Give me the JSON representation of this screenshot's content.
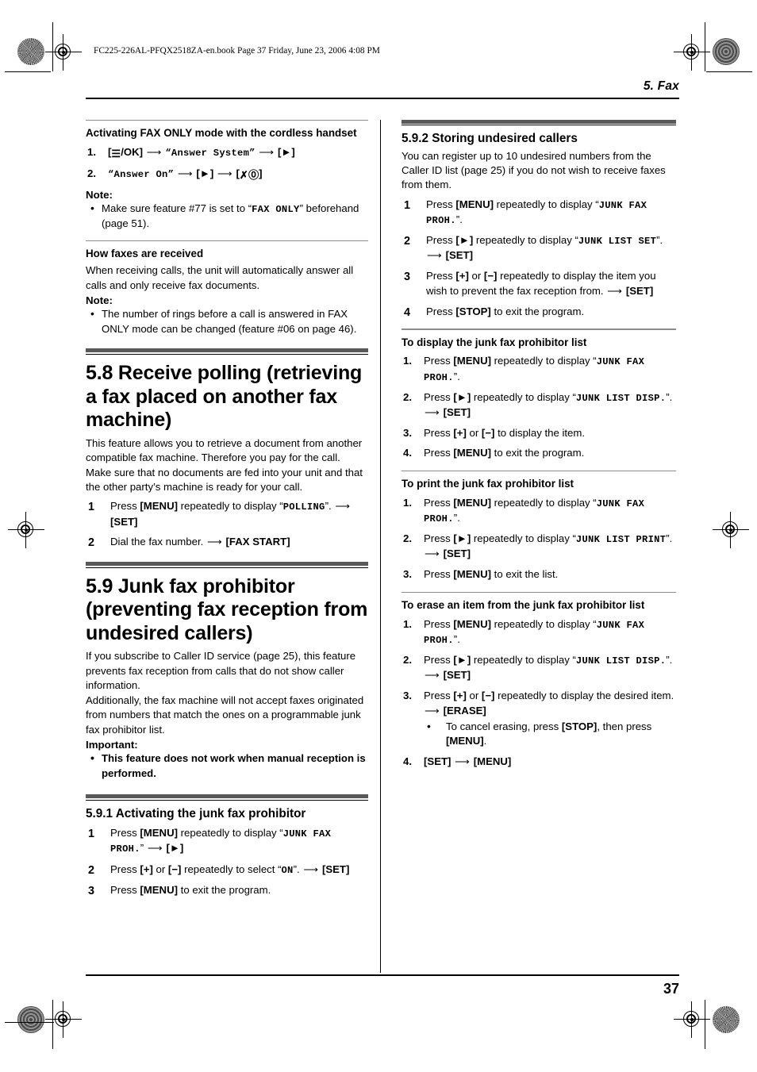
{
  "book_info_line": "FC225-226AL-PFQX2518ZA-en.book  Page 37  Friday, June 23, 2006  4:08 PM",
  "running_head": "5. Fax",
  "folio": "37",
  "left_column": {
    "cordless": {
      "heading": "Activating FAX ONLY mode with the cordless handset",
      "steps": [
        {
          "num": "1.",
          "parts": [
            "key:[≡/OK]",
            "arrow",
            "lcd:“Answer System”",
            "arrow",
            "key:[►]"
          ]
        },
        {
          "num": "2.",
          "parts": [
            "lcd:“Answer On”",
            "arrow",
            "key:[►]",
            "arrow",
            "key:[✗⓪]"
          ]
        }
      ],
      "note_label": "Note:",
      "notes": [
        "Make sure feature #77 is set to “FAX ONLY” beforehand (page 51)."
      ],
      "note_lcd": "FAX ONLY"
    },
    "how_received": {
      "heading": "How faxes are received",
      "body": "When receiving calls, the unit will automatically answer all calls and only receive fax documents.",
      "note_label": "Note:",
      "notes": [
        "The number of rings before a call is answered in FAX ONLY mode can be changed (feature #06 on page 46)."
      ]
    },
    "section_58": {
      "title": "5.8 Receive polling (retrieving a fax placed on another fax machine)",
      "paragraphs": [
        "This feature allows you to retrieve a document from another compatible fax machine. Therefore you pay for the call.",
        "Make sure that no documents are fed into your unit and that the other party’s machine is ready for your call."
      ],
      "steps": [
        {
          "num": "1",
          "text_a": "Press ",
          "key1": "[MENU]",
          "text_b": " repeatedly to display “",
          "lcd": "POLLING",
          "text_c": "”. ",
          "arrow": true,
          "key2": "[SET]"
        },
        {
          "num": "2",
          "text_a": "Dial the fax number. ",
          "arrow": true,
          "key2": "[FAX START]"
        }
      ]
    },
    "section_59": {
      "title": "5.9 Junk fax prohibitor (preventing fax reception from undesired callers)",
      "paragraphs": [
        "If you subscribe to Caller ID service (page 25), this feature prevents fax reception from calls that do not show caller information.",
        "Additionally, the fax machine will not accept faxes originated from numbers that match the ones on a programmable junk fax prohibitor list."
      ],
      "important_label": "Important:",
      "important_items": [
        "This feature does not work when manual reception is performed."
      ]
    },
    "section_591": {
      "title": "5.9.1 Activating the junk fax prohibitor",
      "steps": [
        {
          "num": "1",
          "a": "Press ",
          "k1": "[MENU]",
          "b": " repeatedly to display “",
          "lcd": "JUNK FAX PROH.",
          "c": "” ",
          "arrow": true,
          "k2": "[►]"
        },
        {
          "num": "2",
          "a": "Press ",
          "k1": "[+]",
          "b": " or ",
          "k1b": "[−]",
          "b2": " repeatedly to select “",
          "lcd": "ON",
          "c": "”. ",
          "arrow": true,
          "k2": "[SET]"
        },
        {
          "num": "3",
          "a": "Press ",
          "k1": "[MENU]",
          "b": " to exit the program."
        }
      ]
    }
  },
  "right_column": {
    "section_592": {
      "title": "5.9.2 Storing undesired callers",
      "body": "You can register up to 10 undesired numbers from the Caller ID list (page 25) if you do not wish to receive faxes from them.",
      "steps": [
        {
          "num": "1",
          "a": "Press ",
          "k1": "[MENU]",
          "b": " repeatedly to display “",
          "lcd": "JUNK FAX PROH.",
          "c": "”."
        },
        {
          "num": "2",
          "a": "Press ",
          "k1": "[►]",
          "b": " repeatedly to display “",
          "lcd": "JUNK LIST SET",
          "c": "”. ",
          "arrow": true,
          "k2": "[SET]"
        },
        {
          "num": "3",
          "a": "Press ",
          "k1": "[+]",
          "b": " or ",
          "k1b": "[−]",
          "b2": " repeatedly to display the item you wish to prevent the fax reception from. ",
          "arrow": true,
          "k2": "[SET]"
        },
        {
          "num": "4",
          "a": "Press ",
          "k1": "[STOP]",
          "b": " to exit the program."
        }
      ]
    },
    "display_list": {
      "heading": "To display the junk fax prohibitor list",
      "steps": [
        {
          "num": "1.",
          "a": "Press ",
          "k1": "[MENU]",
          "b": " repeatedly to display “",
          "lcd": "JUNK FAX PROH.",
          "c": "”."
        },
        {
          "num": "2.",
          "a": "Press ",
          "k1": "[►]",
          "b": " repeatedly to display “",
          "lcd": "JUNK LIST DISP.",
          "c": "”. ",
          "arrow": true,
          "k2": "[SET]"
        },
        {
          "num": "3.",
          "a": "Press ",
          "k1": "[+]",
          "b": " or ",
          "k1b": "[−]",
          "b2": " to display the item."
        },
        {
          "num": "4.",
          "a": "Press ",
          "k1": "[MENU]",
          "b": " to exit the program."
        }
      ]
    },
    "print_list": {
      "heading": "To print the junk fax prohibitor list",
      "steps": [
        {
          "num": "1.",
          "a": "Press ",
          "k1": "[MENU]",
          "b": " repeatedly to display “",
          "lcd": "JUNK FAX PROH.",
          "c": "”."
        },
        {
          "num": "2.",
          "a": "Press ",
          "k1": "[►]",
          "b": " repeatedly to display “",
          "lcd": "JUNK LIST PRINT",
          "c": "”. ",
          "arrow": true,
          "k2": "[SET]"
        },
        {
          "num": "3.",
          "a": "Press ",
          "k1": "[MENU]",
          "b": " to exit the list."
        }
      ]
    },
    "erase_item": {
      "heading": "To erase an item from the junk fax prohibitor list",
      "steps": [
        {
          "num": "1.",
          "a": "Press ",
          "k1": "[MENU]",
          "b": " repeatedly to display “",
          "lcd": "JUNK FAX PROH.",
          "c": "”."
        },
        {
          "num": "2.",
          "a": "Press ",
          "k1": "[►]",
          "b": " repeatedly to display “",
          "lcd": "JUNK LIST DISP.",
          "c": "”. ",
          "arrow": true,
          "k2": "[SET]"
        },
        {
          "num": "3.",
          "a": "Press ",
          "k1": "[+]",
          "b": " or ",
          "k1b": "[−]",
          "b2": " repeatedly to display the desired item. ",
          "arrow": true,
          "k2": "[ERASE]",
          "sub": {
            "a": "To cancel erasing, press ",
            "k1": "[STOP]",
            "b": ", then press ",
            "k2": "[MENU]",
            "c": "."
          }
        },
        {
          "num": "4.",
          "k1": "[SET]",
          "arrow": true,
          "k2": "[MENU]"
        }
      ]
    }
  }
}
